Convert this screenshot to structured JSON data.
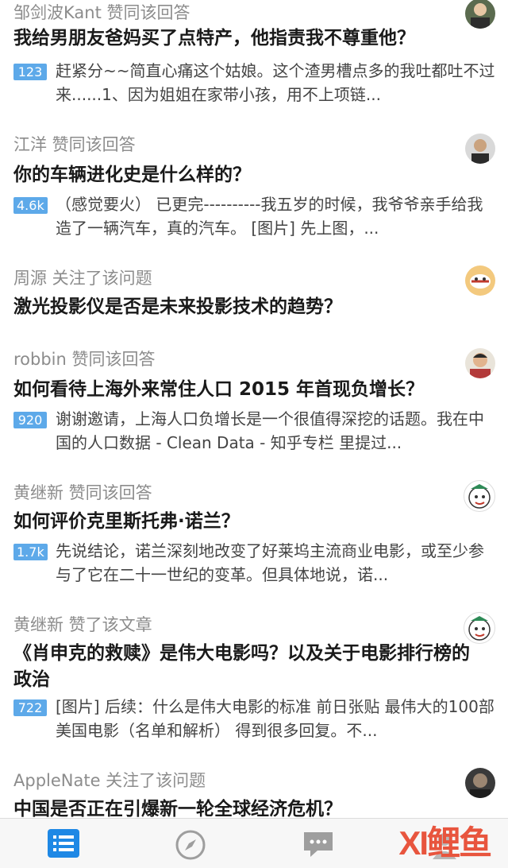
{
  "feed": [
    {
      "meta": "邹剑波Kant 赞同该回答",
      "title": "我给男朋友爸妈买了点特产，他指责我不尊重他？",
      "badge": "123",
      "excerpt": "赶紧分~~简直心痛这个姑娘。这个渣男槽点多的我吐都吐不过来......1、因为姐姐在家带小孩，用不上项链..."
    },
    {
      "meta": "江洋 赞同该回答",
      "title": "你的车辆进化史是什么样的？",
      "badge": "4.6k",
      "excerpt": "（感觉要火） 已更完----------我五岁的时候，我爷爷亲手给我造了一辆汽车，真的汽车。 [图片] 先上图，..."
    },
    {
      "meta": "周源 关注了该问题",
      "title": "激光投影仪是否是未来投影技术的趋势？"
    },
    {
      "meta": "robbin 赞同该回答",
      "title": "如何看待上海外来常住人口 2015 年首现负增长？",
      "badge": "920",
      "excerpt": "谢谢邀请，上海人口负增长是一个很值得深挖的话题。我在中国的人口数据 - Clean Data - 知乎专栏 里提过..."
    },
    {
      "meta": "黄继新 赞同该回答",
      "title": "如何评价克里斯托弗·诺兰？",
      "badge": "1.7k",
      "excerpt": "先说结论，诺兰深刻地改变了好莱坞主流商业电影，或至少参与了它在二十一世纪的变革。但具体地说，诺..."
    },
    {
      "meta": "黄继新 赞了该文章",
      "title": "《肖申克的救赎》是伟大电影吗？以及关于电影排行榜的政治",
      "badge": "722",
      "excerpt": "[图片] 后续：什么是伟大电影的标准 前日张贴 最伟大的100部美国电影（名单和解析） 得到很多回复。不..."
    },
    {
      "meta": "AppleNate 关注了该问题",
      "title": "中国是否正在引爆新一轮全球经济危机？"
    }
  ],
  "tabbar": {
    "items": [
      "home-feed-icon",
      "explore-compass-icon",
      "messages-icon",
      "profile-icon"
    ],
    "accent": "#1e88e5"
  },
  "watermark": "XI鲤鱼",
  "colors": {
    "badge": "#5da9e9",
    "meta": "#8c8c8c"
  }
}
